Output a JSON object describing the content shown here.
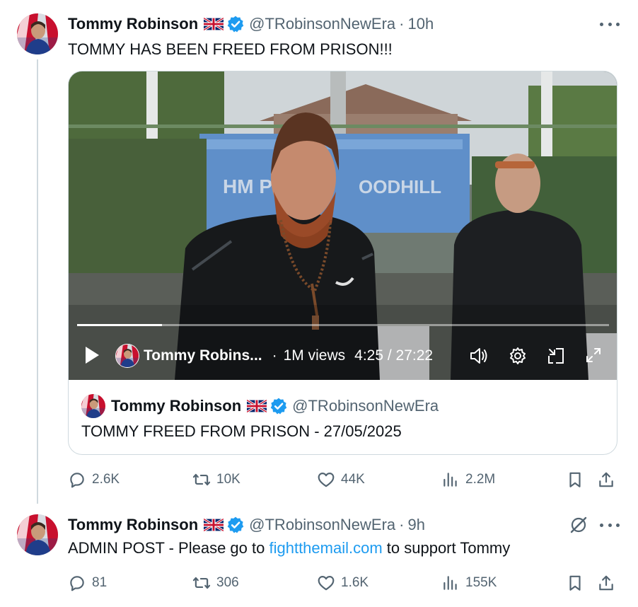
{
  "colors": {
    "text": "#0f1419",
    "secondary": "#536471",
    "link": "#1d9bf0",
    "verified": "#1d9bf0",
    "divider": "#cfd9de"
  },
  "tweets": [
    {
      "author": "Tommy Robinson",
      "handle": "@TRobinsonNewEra",
      "separator": "·",
      "time": "10h",
      "text": "TOMMY HAS BEEN FREED FROM PRISON!!!",
      "video": {
        "channel_name": "Tommy Robins...",
        "separator": "·",
        "views": "1M views",
        "timestamp": "4:25 / 27:22",
        "progress_fraction": 0.16,
        "sign_text": "HM P",
        "sign_text_2": "OODHILL"
      },
      "quote": {
        "author": "Tommy Robinson",
        "handle": "@TRobinsonNewEra",
        "text": "TOMMY FREED FROM PRISON - 27/05/2025"
      },
      "stats": {
        "replies": "2.6K",
        "reposts": "10K",
        "likes": "44K",
        "views": "2.2M"
      }
    },
    {
      "author": "Tommy Robinson",
      "handle": "@TRobinsonNewEra",
      "separator": "·",
      "time": "9h",
      "text_prefix": "ADMIN POST - Please go to ",
      "link_text": "fightthemail.com",
      "text_suffix": " to support Tommy",
      "stats": {
        "replies": "81",
        "reposts": "306",
        "likes": "1.6K",
        "views": "155K"
      }
    }
  ],
  "icons": [
    "uk-flag-icon",
    "verified-badge-icon",
    "more-icon",
    "play-icon",
    "volume-icon",
    "settings-gear-icon",
    "pip-icon",
    "fullscreen-icon",
    "reply-icon",
    "repost-icon",
    "like-icon",
    "views-icon",
    "bookmark-icon",
    "share-icon",
    "grok-icon"
  ]
}
